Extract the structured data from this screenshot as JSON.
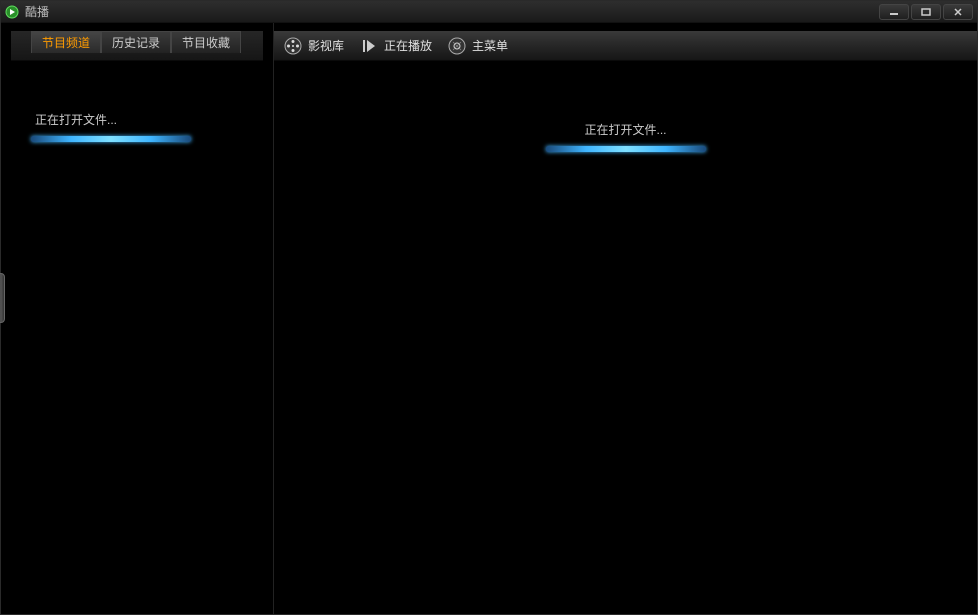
{
  "app": {
    "title": "酷播"
  },
  "sidebar": {
    "tabs": [
      {
        "label": "节目频道",
        "active": true
      },
      {
        "label": "历史记录",
        "active": false
      },
      {
        "label": "节目收藏",
        "active": false
      }
    ],
    "loading_text": "正在打开文件..."
  },
  "toolbar": {
    "items": [
      {
        "label": "影视库",
        "icon": "film-reel-icon"
      },
      {
        "label": "正在播放",
        "icon": "play-icon"
      },
      {
        "label": "主菜单",
        "icon": "menu-disc-icon"
      }
    ]
  },
  "content": {
    "loading_text": "正在打开文件..."
  },
  "colors": {
    "accent_orange": "#ff9c00",
    "progress_blue": "#3fb5ff"
  }
}
